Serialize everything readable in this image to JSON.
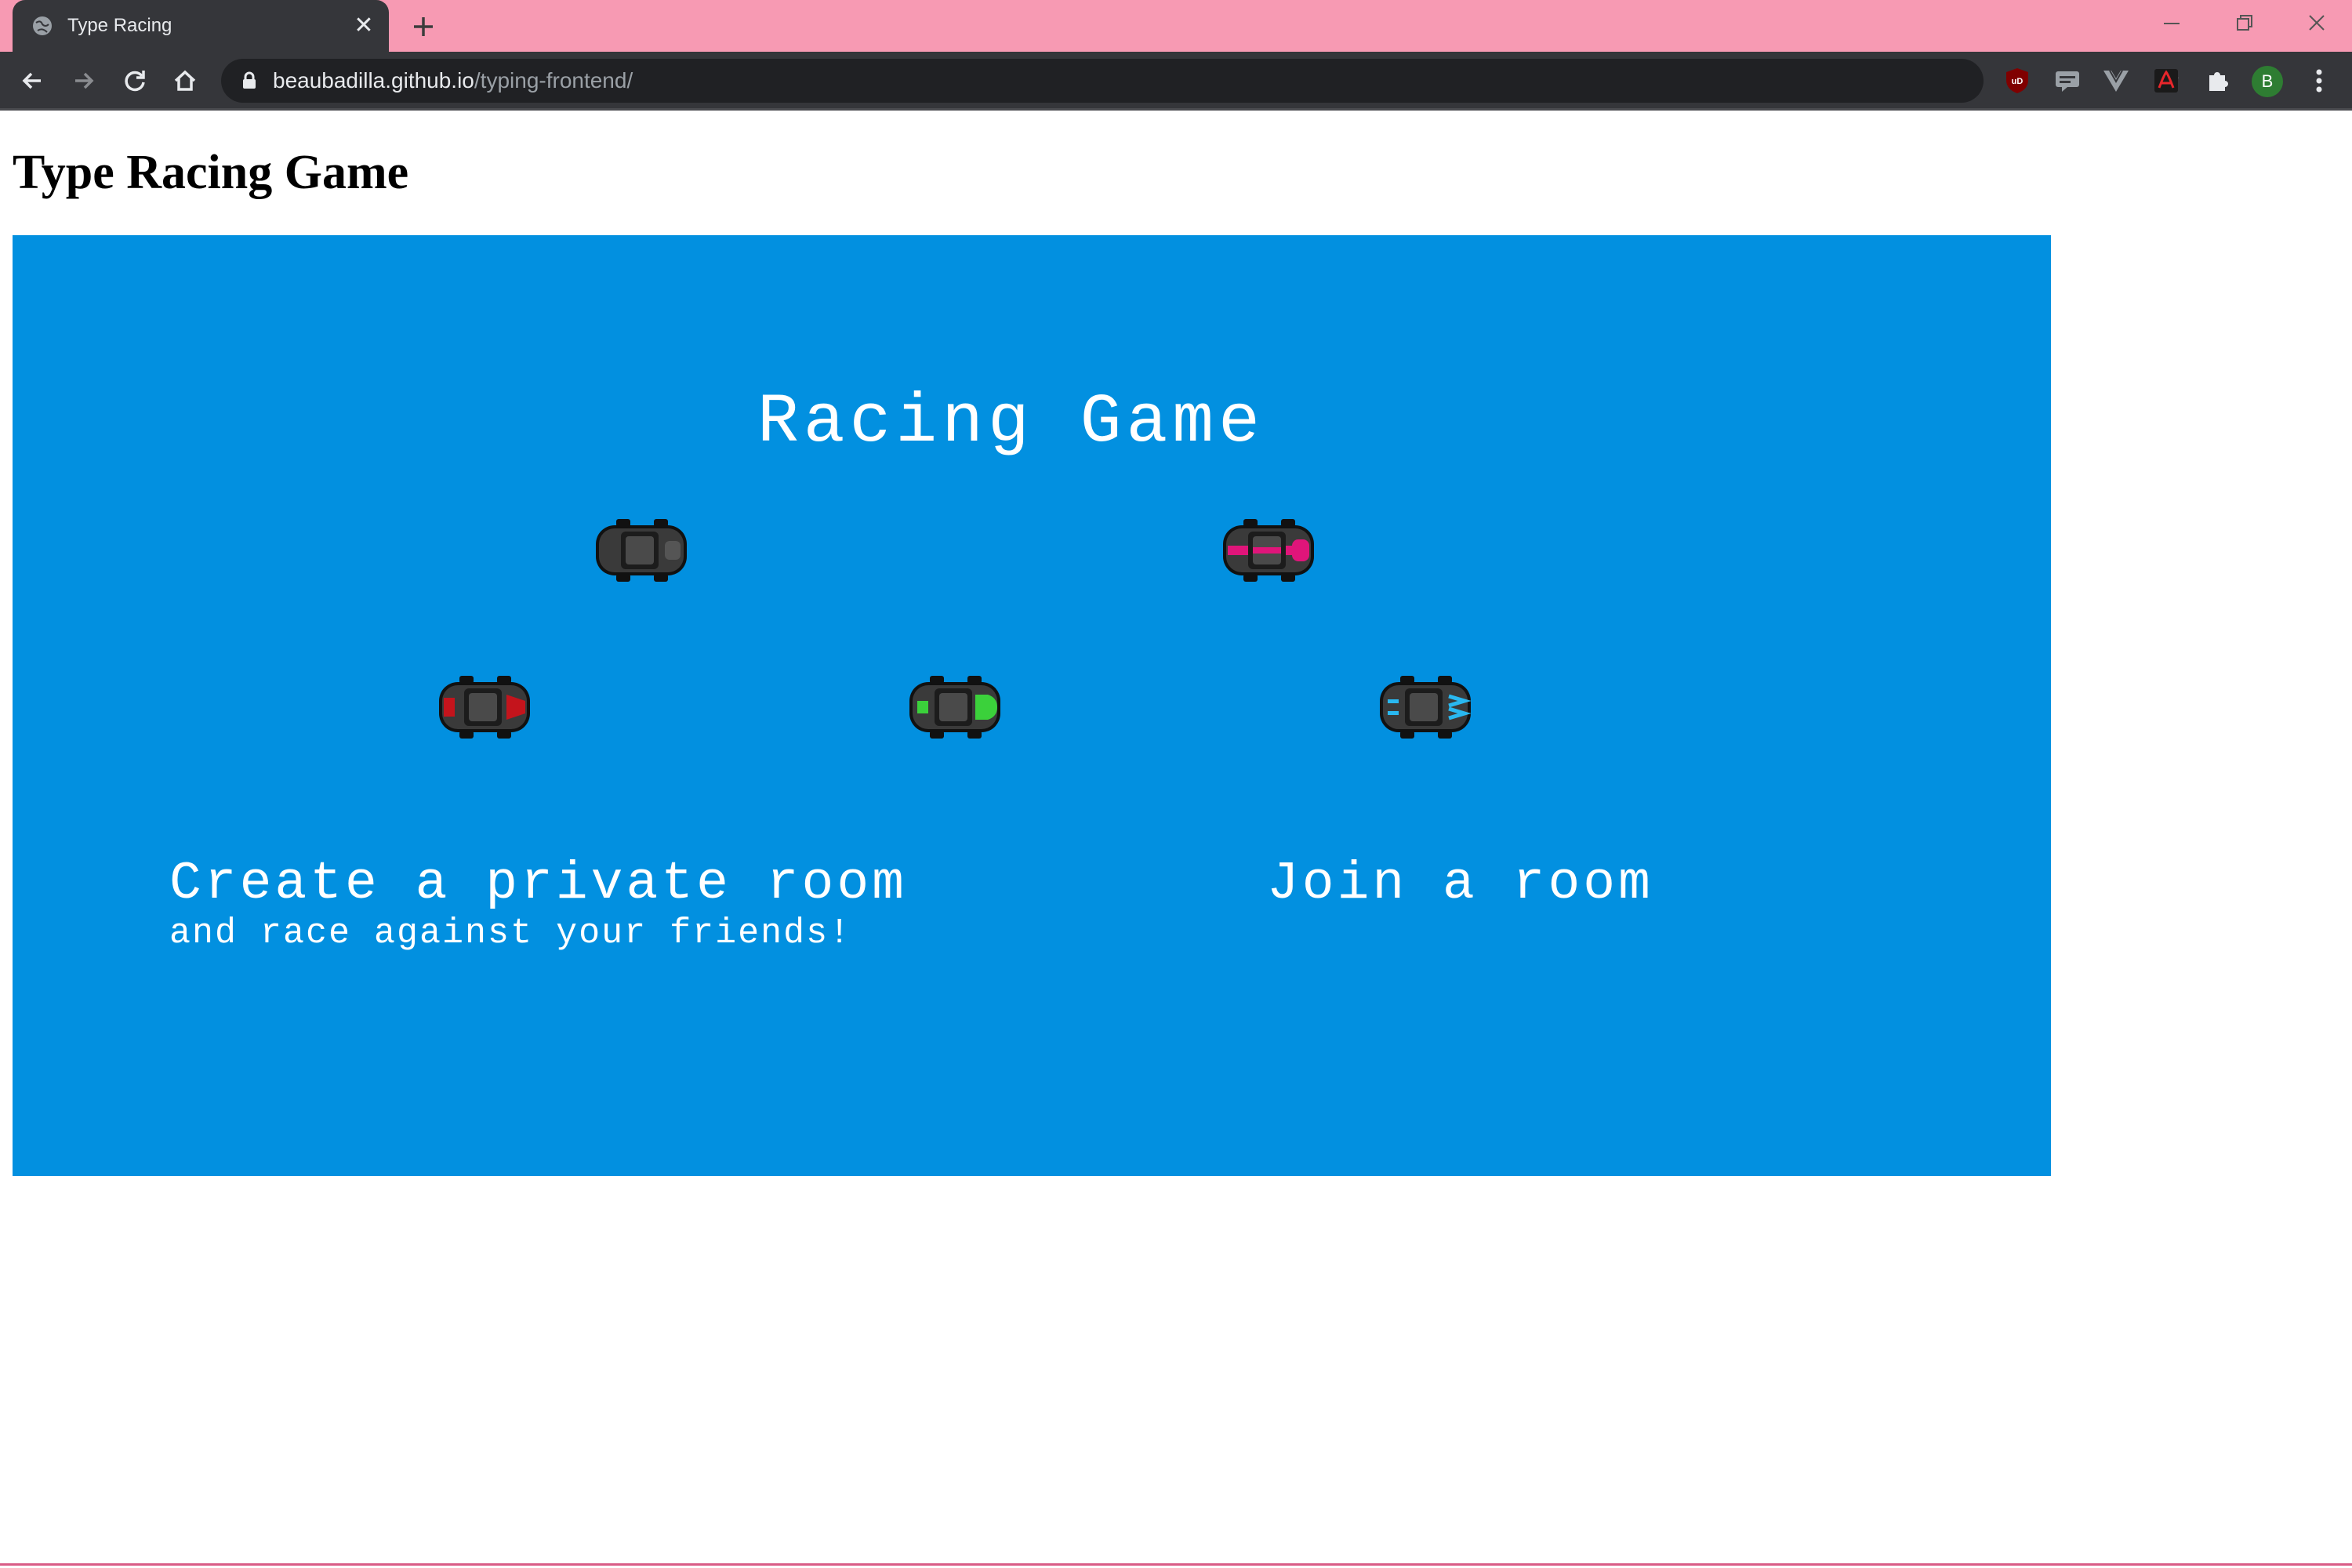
{
  "browser": {
    "tab_title": "Type Racing",
    "tab_close_glyph": "✕",
    "url_host": "beaubadilla.github.io",
    "url_path": "/typing-frontend/",
    "profile_initial": "B",
    "tabstrip_color": "#f79ab3",
    "toolbar_color": "#35363a",
    "extensions": [
      "ublock-origin-icon",
      "subtitles-extension-icon",
      "vue-devtools-icon",
      "adobe-acrobat-icon",
      "extensions-puzzle-icon"
    ]
  },
  "page": {
    "heading": "Type Racing Game"
  },
  "game": {
    "background_color": "#0290e0",
    "title": "Racing Game",
    "cars": [
      {
        "name": "car-gray",
        "accent": "#555555"
      },
      {
        "name": "car-pink",
        "accent": "#e0157a"
      },
      {
        "name": "car-red",
        "accent": "#c4141c"
      },
      {
        "name": "car-green",
        "accent": "#3bd13b"
      },
      {
        "name": "car-blue",
        "accent": "#29b8f0"
      }
    ],
    "create_room": {
      "label": "Create a private room",
      "sublabel": "and race against your friends!"
    },
    "join_room": {
      "label": "Join a room"
    }
  }
}
